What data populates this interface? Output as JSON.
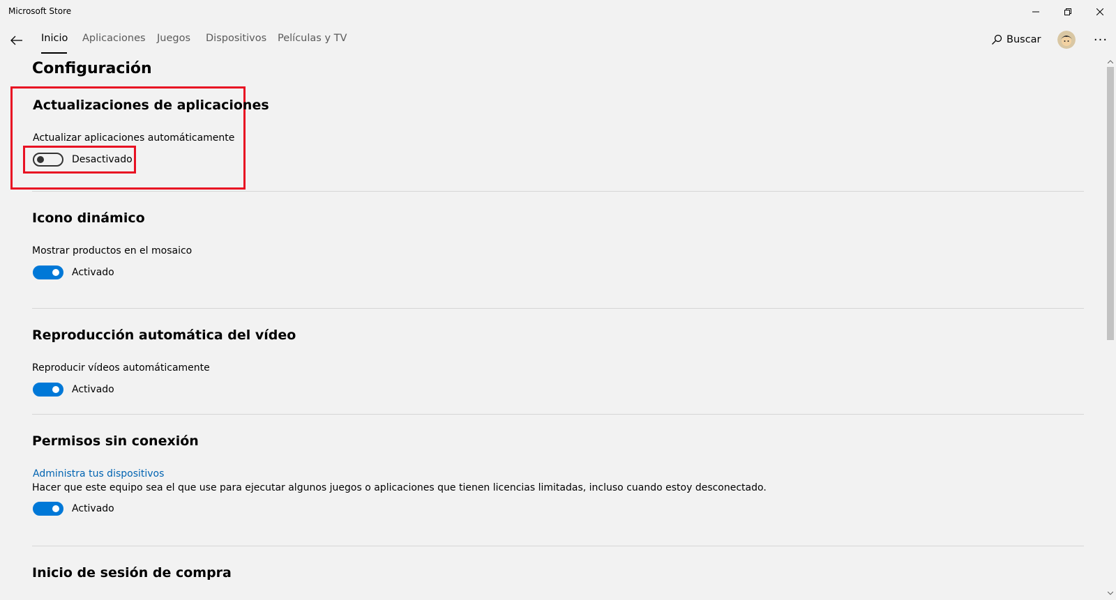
{
  "window": {
    "title": "Microsoft Store"
  },
  "nav": {
    "tabs": [
      {
        "label": "Inicio",
        "active": true
      },
      {
        "label": "Aplicaciones",
        "active": false
      },
      {
        "label": "Juegos",
        "active": false
      },
      {
        "label": "Dispositivos",
        "active": false
      },
      {
        "label": "Películas y TV",
        "active": false
      }
    ],
    "search_label": "Buscar",
    "more_label": "···"
  },
  "page": {
    "title": "Configuración"
  },
  "sections": [
    {
      "title": "Actualizaciones de aplicaciones",
      "setting_label": "Actualizar aplicaciones automáticamente",
      "toggle_state": "off",
      "toggle_label": "Desactivado"
    },
    {
      "title": "Icono dinámico",
      "setting_label": "Mostrar productos en el mosaico",
      "toggle_state": "on",
      "toggle_label": "Activado"
    },
    {
      "title": "Reproducción automática del vídeo",
      "setting_label": "Reproducir vídeos automáticamente",
      "toggle_state": "on",
      "toggle_label": "Activado"
    },
    {
      "title": "Permisos sin conexión",
      "link_label": "Administra tus dispositivos",
      "description": "Hacer que este equipo sea el que use para ejecutar algunos juegos o aplicaciones que tienen licencias limitadas, incluso cuando estoy desconectado.",
      "toggle_state": "on",
      "toggle_label": "Activado"
    },
    {
      "title": "Inicio de sesión de compra"
    }
  ],
  "colors": {
    "accent": "#0078d7",
    "link": "#0063b1",
    "highlight": "#e81123",
    "background": "#f2f2f2"
  }
}
